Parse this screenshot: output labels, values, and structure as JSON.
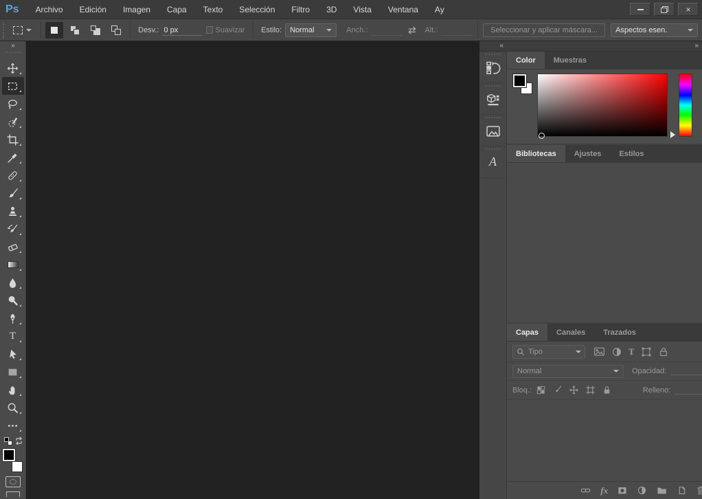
{
  "menu_bar": {
    "logo": "Ps",
    "items": [
      "Archivo",
      "Edición",
      "Imagen",
      "Capa",
      "Texto",
      "Selección",
      "Filtro",
      "3D",
      "Vista",
      "Ventana",
      "Ay"
    ]
  },
  "window_controls": {
    "minimize": "–",
    "restore": "restore",
    "close": "×"
  },
  "options_bar": {
    "feather_label": "Desv.:",
    "feather_value": "0 px",
    "antialias_label": "Suavizar",
    "style_label": "Estilo:",
    "style_value": "Normal",
    "width_label": "Anch.:",
    "width_value": "",
    "height_label": "Alt.:",
    "height_value": "",
    "select_mask_label": "Seleccionar y aplicar máscara...",
    "workspace_value": "Aspectos esen."
  },
  "toolbar": {
    "selected_tool": "rectangular-marquee",
    "tools": [
      "move",
      "rectangular-marquee",
      "lasso",
      "quick-selection",
      "crop",
      "eyedropper",
      "spot-healing-brush",
      "brush",
      "clone-stamp",
      "history-brush",
      "eraser",
      "gradient",
      "blur",
      "dodge",
      "pen",
      "type",
      "path-selection",
      "rectangle",
      "hand",
      "zoom",
      "edit-toolbar"
    ],
    "foreground_color": "#000000",
    "background_color": "#ffffff"
  },
  "dock": {
    "collapsed_icons": [
      "history",
      "3d",
      "photos",
      "glyphs"
    ],
    "color_panel": {
      "tabs": [
        "Color",
        "Muestras"
      ],
      "active_tab": "Color",
      "hue": "#ff0000",
      "foreground_color": "#000000",
      "background_color": "#ffffff"
    },
    "libraries_panel": {
      "tabs": [
        "Bibliotecas",
        "Ajustes",
        "Estilos"
      ],
      "active_tab": "Bibliotecas"
    },
    "layers_panel": {
      "tabs": [
        "Capas",
        "Canales",
        "Trazados"
      ],
      "active_tab": "Capas",
      "filter_label": "Tipo",
      "blend_mode": "Normal",
      "opacity_label": "Opacidad:",
      "lock_label": "Bloq.:",
      "fill_label": "Relleno:",
      "fx_label": "fx"
    }
  }
}
